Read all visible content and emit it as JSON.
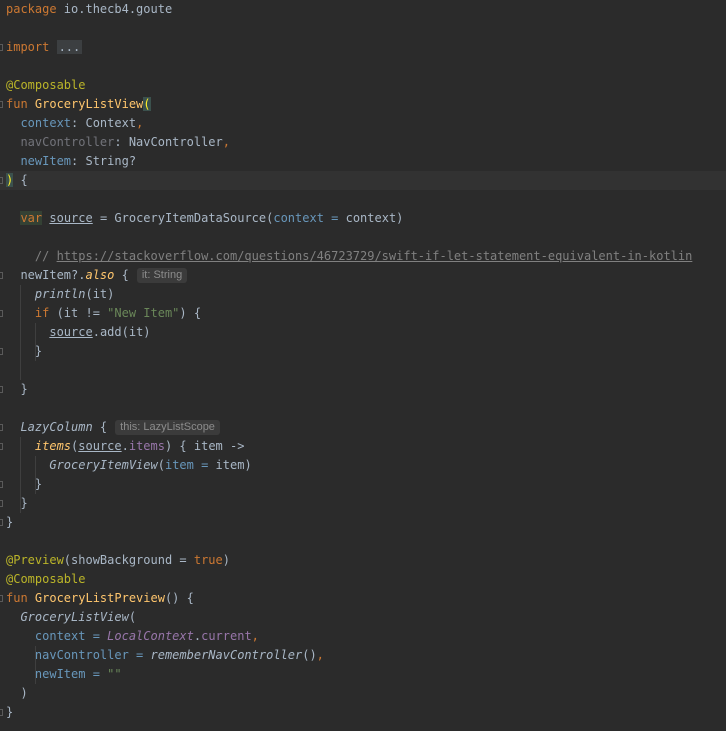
{
  "editor": {
    "lines": [
      {
        "type": "code",
        "tokens": [
          {
            "t": "package ",
            "c": "kw"
          },
          {
            "t": "io.thecb4.goute"
          }
        ]
      },
      {
        "type": "blank"
      },
      {
        "type": "code",
        "gutter": true,
        "tokens": [
          {
            "t": "import ",
            "c": "kw"
          },
          {
            "t": "...",
            "c": "fold"
          }
        ]
      },
      {
        "type": "blank"
      },
      {
        "type": "code",
        "tokens": [
          {
            "t": "@Composable",
            "c": "ann"
          }
        ]
      },
      {
        "type": "code",
        "gutter": true,
        "tokens": [
          {
            "t": "fun ",
            "c": "kw"
          },
          {
            "t": "GroceryListView",
            "c": "fn"
          },
          {
            "t": "(",
            "c": "brace-hl"
          }
        ]
      },
      {
        "type": "code",
        "tokens": [
          {
            "t": "  context",
            "c": "param"
          },
          {
            "t": ": Context"
          },
          {
            "t": ",",
            "c": "kw"
          }
        ]
      },
      {
        "type": "code",
        "tokens": [
          {
            "t": "  navController",
            "c": "dim"
          },
          {
            "t": ": NavController"
          },
          {
            "t": ",",
            "c": "kw"
          }
        ]
      },
      {
        "type": "code",
        "tokens": [
          {
            "t": "  newItem",
            "c": "param"
          },
          {
            "t": ": String?"
          }
        ]
      },
      {
        "type": "code",
        "current": true,
        "gutter": true,
        "tokens": [
          {
            "t": ")",
            "c": "brace-hl"
          },
          {
            "t": " {"
          }
        ]
      },
      {
        "type": "blank"
      },
      {
        "type": "code",
        "tokens": [
          {
            "t": "  "
          },
          {
            "t": "var",
            "c": "kw var-hl"
          },
          {
            "t": " "
          },
          {
            "t": "source",
            "c": "ul"
          },
          {
            "t": " = GroceryItemDataSource("
          },
          {
            "t": "context = ",
            "c": "param"
          },
          {
            "t": "context)"
          }
        ]
      },
      {
        "type": "blank"
      },
      {
        "type": "code",
        "tokens": [
          {
            "t": "    // ",
            "c": "cmt"
          },
          {
            "t": "https://stackoverflow.com/questions/46723729/swift-if-let-statement-equivalent-in-kotlin",
            "c": "link"
          }
        ]
      },
      {
        "type": "code",
        "gutter": true,
        "tokens": [
          {
            "t": "  newItem?."
          },
          {
            "t": "also",
            "c": "fnit"
          },
          {
            "t": " {"
          }
        ],
        "hint": "it: String"
      },
      {
        "type": "code",
        "tokens": [
          {
            "t": "    println",
            "c": "it"
          },
          {
            "t": "(it)"
          }
        ]
      },
      {
        "type": "code",
        "gutter": true,
        "tokens": [
          {
            "t": "    "
          },
          {
            "t": "if",
            "c": "kw"
          },
          {
            "t": " (it != "
          },
          {
            "t": "\"New Item\"",
            "c": "str"
          },
          {
            "t": ") {"
          }
        ]
      },
      {
        "type": "code",
        "tokens": [
          {
            "t": "      "
          },
          {
            "t": "source",
            "c": "ul"
          },
          {
            "t": ".add(it)"
          }
        ]
      },
      {
        "type": "code",
        "gutter": true,
        "tokens": [
          {
            "t": "    }"
          }
        ]
      },
      {
        "type": "blank"
      },
      {
        "type": "code",
        "gutter": true,
        "tokens": [
          {
            "t": "  }"
          }
        ]
      },
      {
        "type": "blank"
      },
      {
        "type": "code",
        "gutter": true,
        "tokens": [
          {
            "t": "  "
          },
          {
            "t": "LazyColumn",
            "c": "it"
          },
          {
            "t": " {"
          }
        ],
        "hint": "this: LazyListScope"
      },
      {
        "type": "code",
        "gutter": true,
        "tokens": [
          {
            "t": "    "
          },
          {
            "t": "items",
            "c": "fnit"
          },
          {
            "t": "("
          },
          {
            "t": "source",
            "c": "ul"
          },
          {
            "t": "."
          },
          {
            "t": "items",
            "c": "prop"
          },
          {
            "t": ") { item ->"
          }
        ]
      },
      {
        "type": "code",
        "tokens": [
          {
            "t": "      "
          },
          {
            "t": "GroceryItemView",
            "c": "it"
          },
          {
            "t": "("
          },
          {
            "t": "item = ",
            "c": "param"
          },
          {
            "t": "item)"
          }
        ]
      },
      {
        "type": "code",
        "gutter": true,
        "tokens": [
          {
            "t": "    }"
          }
        ]
      },
      {
        "type": "code",
        "gutter": true,
        "tokens": [
          {
            "t": "  }"
          }
        ]
      },
      {
        "type": "code",
        "gutter": true,
        "tokens": [
          {
            "t": "}"
          }
        ]
      },
      {
        "type": "blank"
      },
      {
        "type": "code",
        "tokens": [
          {
            "t": "@Preview",
            "c": "ann"
          },
          {
            "t": "(showBackground = "
          },
          {
            "t": "true",
            "c": "kw"
          },
          {
            "t": ")"
          }
        ]
      },
      {
        "type": "code",
        "tokens": [
          {
            "t": "@Composable",
            "c": "ann"
          }
        ]
      },
      {
        "type": "code",
        "gutter": true,
        "tokens": [
          {
            "t": "fun ",
            "c": "kw"
          },
          {
            "t": "GroceryListPreview",
            "c": "fn"
          },
          {
            "t": "() {"
          }
        ]
      },
      {
        "type": "code",
        "tokens": [
          {
            "t": "  "
          },
          {
            "t": "GroceryListView",
            "c": "it"
          },
          {
            "t": "("
          }
        ]
      },
      {
        "type": "code",
        "tokens": [
          {
            "t": "    context = ",
            "c": "param"
          },
          {
            "t": "LocalContext",
            "c": "prop it"
          },
          {
            "t": "."
          },
          {
            "t": "current",
            "c": "prop"
          },
          {
            "t": ",",
            "c": "kw"
          }
        ]
      },
      {
        "type": "code",
        "tokens": [
          {
            "t": "    navController = ",
            "c": "param"
          },
          {
            "t": "rememberNavController",
            "c": "it"
          },
          {
            "t": "()"
          },
          {
            "t": ",",
            "c": "kw"
          }
        ]
      },
      {
        "type": "code",
        "tokens": [
          {
            "t": "    newItem = ",
            "c": "param"
          },
          {
            "t": "\"\"",
            "c": "str"
          }
        ]
      },
      {
        "type": "code",
        "tokens": [
          {
            "t": "  )"
          }
        ]
      },
      {
        "type": "code",
        "gutter": true,
        "tokens": [
          {
            "t": "}"
          }
        ]
      }
    ]
  }
}
